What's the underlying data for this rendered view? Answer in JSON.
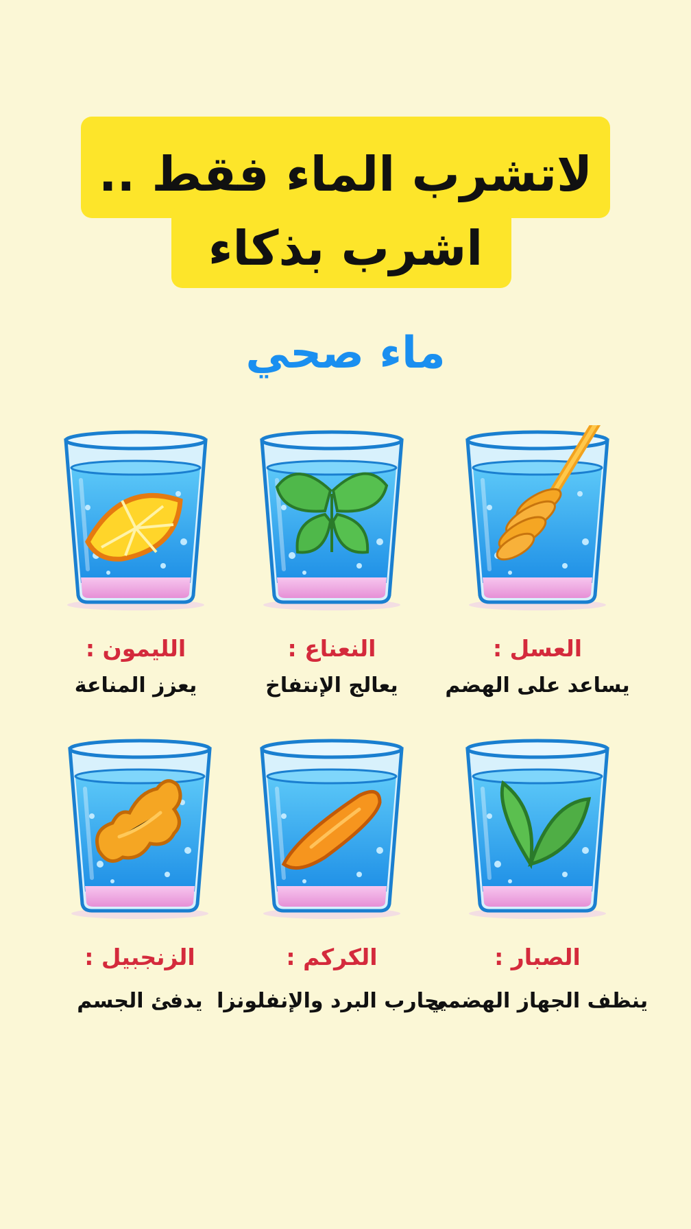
{
  "title": {
    "line1": "لاتشرب الماء فقط ..",
    "line2": "اشرب بذكاء"
  },
  "subtitle": "ماء صحي",
  "items": [
    {
      "name": "العسل :",
      "desc": "يساعد على الهضم",
      "icon": "honey-dipper-icon"
    },
    {
      "name": "النعناع :",
      "desc": "يعالج الإنتفاخ",
      "icon": "mint-leaves-icon"
    },
    {
      "name": "الليمون :",
      "desc": "يعزز المناعة",
      "icon": "lemon-slice-icon"
    },
    {
      "name": "الصبار :",
      "desc": "ينظف الجهاز الهضمي",
      "icon": "aloe-leaves-icon"
    },
    {
      "name": "الكركم :",
      "desc": "يحارب البرد والإنفلونزا",
      "icon": "turmeric-root-icon"
    },
    {
      "name": "الزنجبيل :",
      "desc": "يدفئ الجسم",
      "icon": "ginger-root-icon"
    }
  ],
  "colors": {
    "background": "#fbf7d6",
    "banner": "#fde52a",
    "subtitle": "#1a8ff0",
    "item_name": "#d42a3c",
    "water": "#2aa8ef",
    "glass_base": "#f3a9e3"
  }
}
